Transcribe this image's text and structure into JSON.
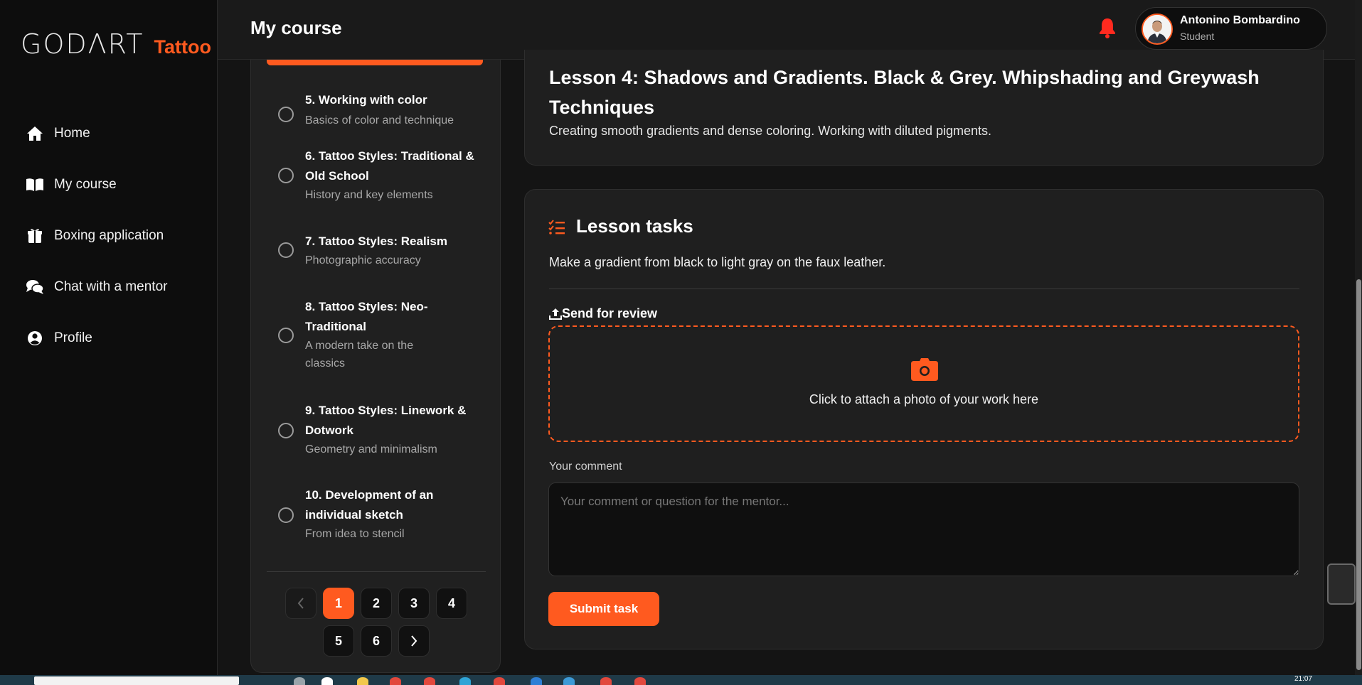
{
  "brand": {
    "name": "GODΛRT",
    "suffix": "Tattoo"
  },
  "colors": {
    "accent": "#ff5a1f",
    "bg": "#141414",
    "sidebar": "#0d0d0d",
    "card": "#1f1f1f",
    "bell": "#ff2a1f"
  },
  "nav": [
    {
      "label": "Home",
      "icon": "home-icon"
    },
    {
      "label": "My course",
      "icon": "book-icon"
    },
    {
      "label": "Boxing application",
      "icon": "gift-box-icon"
    },
    {
      "label": "Chat with a mentor",
      "icon": "chat-icon"
    },
    {
      "label": "Profile",
      "icon": "user-circle-icon"
    }
  ],
  "header": {
    "title": "My course",
    "user": {
      "name": "Antonino Bombardino",
      "role": "Student"
    }
  },
  "lessons": [
    {
      "title": "5. Working with color",
      "subtitle": "Basics of color and technique"
    },
    {
      "title": "6. Tattoo Styles: Traditional & Old School",
      "subtitle": "History and key elements"
    },
    {
      "title": "7. Tattoo Styles: Realism",
      "subtitle": "Photographic accuracy"
    },
    {
      "title": "8. Tattoo Styles: Neo-Traditional",
      "subtitle": "A modern take on the classics"
    },
    {
      "title": "9. Tattoo Styles: Linework & Dotwork",
      "subtitle": "Geometry and minimalism"
    },
    {
      "title": "10. Development of an individual sketch",
      "subtitle": "From idea to stencil"
    }
  ],
  "pagination": {
    "pages": [
      "1",
      "2",
      "3",
      "4",
      "5",
      "6"
    ],
    "current": "1"
  },
  "lesson": {
    "heading": "Lesson 4: Shadows and Gradients. Black & Grey. Whipshading and Greywash Techniques",
    "description": "Creating smooth gradients and dense coloring. Working with diluted pigments."
  },
  "tasks": {
    "title": "Lesson tasks",
    "text": "Make a gradient from black to light gray on the faux leather.",
    "send_label": "Send for review",
    "dropzone_text": "Click to attach a photo of your work here",
    "comment_label": "Your comment",
    "comment_placeholder": "Your comment or question for the mentor...",
    "submit_label": "Submit task"
  },
  "taskbar": {
    "time": "21:07"
  }
}
